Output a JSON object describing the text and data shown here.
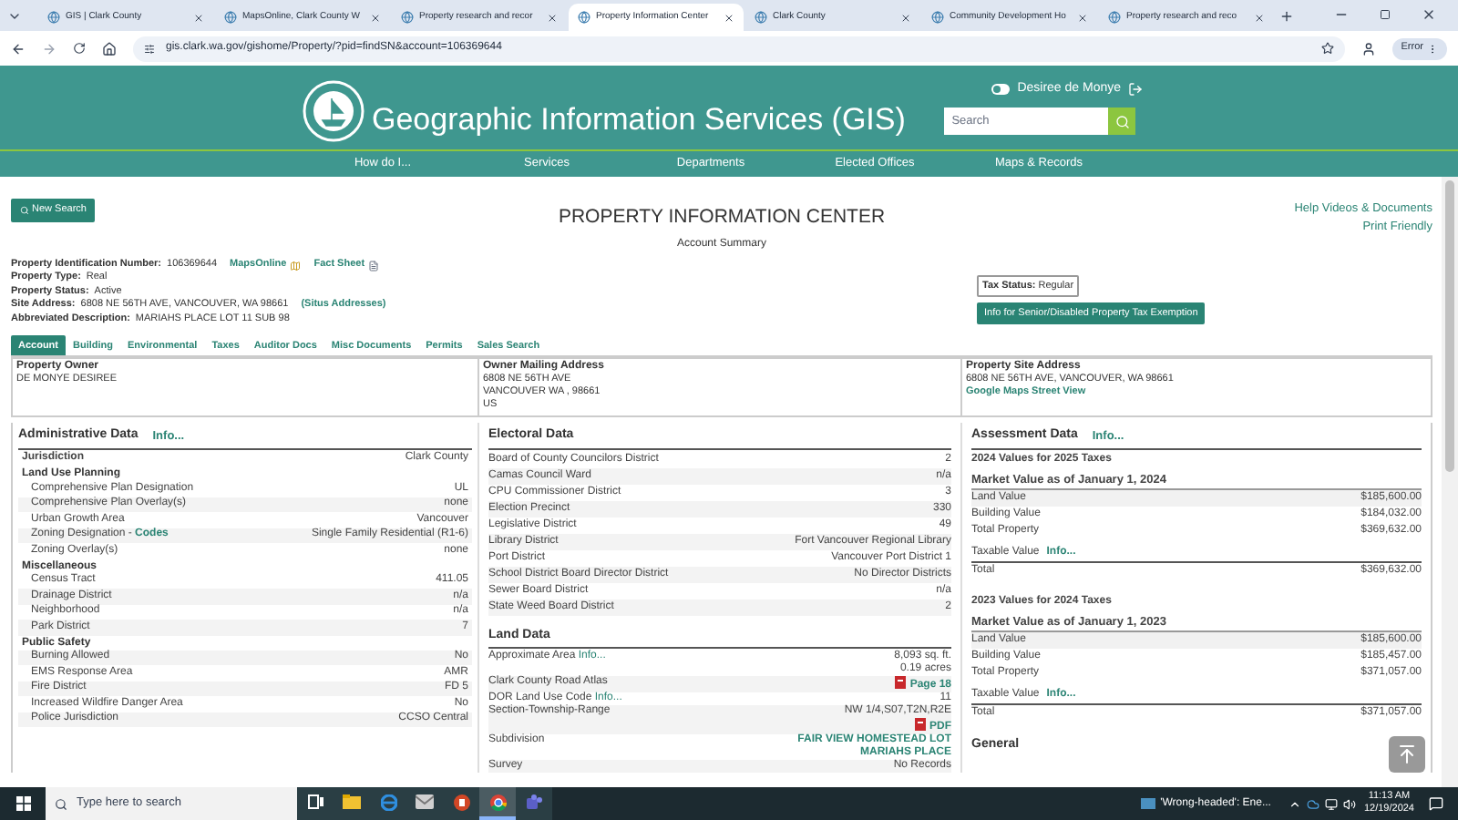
{
  "browser": {
    "tabs": [
      {
        "title": "GIS | Clark County",
        "selected": false
      },
      {
        "title": "MapsOnline, Clark County W",
        "selected": false
      },
      {
        "title": "Property research and recor",
        "selected": false
      },
      {
        "title": "Property Information Center",
        "selected": true
      },
      {
        "title": "Clark County",
        "selected": false
      },
      {
        "title": "Community Development Ho",
        "selected": false
      },
      {
        "title": "Property research and reco",
        "selected": false
      }
    ],
    "address": "gis.clark.wa.gov/gishome/Property/?pid=findSN&account=106369644",
    "profile": "Error"
  },
  "header": {
    "user": "Desiree de Monye",
    "title": "Geographic Information Services (GIS)",
    "search": {
      "placeholder": "Search"
    },
    "nav": [
      "How do I...",
      "Services",
      "Departments",
      "Elected Offices",
      "Maps & Records"
    ]
  },
  "page": {
    "new_search": "New Search",
    "title": "PROPERTY INFORMATION CENTER",
    "subtitle": "Account Summary",
    "links": [
      "Help Videos & Documents",
      "Print Friendly"
    ],
    "fields": [
      {
        "label": "Property Identification Number:",
        "value": "106369644",
        "links": [
          "MapsOnline",
          "Fact Sheet"
        ]
      },
      {
        "label": "Property Type:",
        "value": "Real"
      },
      {
        "label": "Property Status:",
        "value": "Active"
      },
      {
        "label": "Site Address:",
        "value": "6808 NE 56TH AVE, VANCOUVER, WA 98661",
        "links": [
          "(Situs Addresses)"
        ]
      },
      {
        "label": "Abbreviated Description:",
        "value": "MARIAHS PLACE LOT 11 SUB 98"
      }
    ],
    "tax_status": {
      "label": "Tax Status:",
      "value": "Regular"
    },
    "exemption_button": "Info for Senior/Disabled Property Tax Exemption",
    "tabs": [
      {
        "label": "Account",
        "selected": true
      },
      {
        "label": "Building",
        "selected": false
      },
      {
        "label": "Environmental",
        "selected": false
      },
      {
        "label": "Taxes",
        "selected": false
      },
      {
        "label": "Auditor Docs",
        "selected": false
      },
      {
        "label": "Misc Documents",
        "selected": false
      },
      {
        "label": "Permits",
        "selected": false
      },
      {
        "label": "Sales Search",
        "selected": false
      }
    ],
    "owner": {
      "title": "Property Owner",
      "lines": [
        "DE MONYE DESIREE"
      ]
    },
    "mailing": {
      "title": "Owner Mailing Address",
      "lines": [
        "6808 NE 56TH AVE",
        "VANCOUVER WA , 98661",
        "US"
      ]
    },
    "site": {
      "title": "Property Site Address",
      "lines": [
        "6808 NE 56TH AVE, VANCOUVER, WA 98661"
      ],
      "link": "Google Maps Street View"
    }
  },
  "admin": {
    "title": "Administrative Data",
    "link": "Info...",
    "rows": [
      {
        "kind": "main",
        "label": "Jurisdiction",
        "value": "Clark County"
      },
      {
        "kind": "heading",
        "label": "Land Use Planning"
      },
      {
        "kind": "row",
        "label": "Comprehensive Plan Designation",
        "value": "UL"
      },
      {
        "kind": "row",
        "label": "Comprehensive Plan Overlay(s)",
        "value": "none"
      },
      {
        "kind": "row",
        "label": "Urban Growth Area",
        "value": "Vancouver"
      },
      {
        "kind": "row",
        "label": "Zoning Designation -",
        "link": "Codes",
        "value": "Single Family Residential (R1-6)"
      },
      {
        "kind": "row",
        "label": "Zoning Overlay(s)",
        "value": "none"
      },
      {
        "kind": "heading",
        "label": "Miscellaneous"
      },
      {
        "kind": "row",
        "label": "Census Tract",
        "value": "411.05"
      },
      {
        "kind": "row",
        "label": "Drainage District",
        "value": "n/a"
      },
      {
        "kind": "row",
        "label": "Neighborhood",
        "value": "n/a"
      },
      {
        "kind": "row",
        "label": "Park District",
        "value": "7"
      },
      {
        "kind": "heading",
        "label": "Public Safety"
      },
      {
        "kind": "row",
        "label": "Burning Allowed",
        "value": "No"
      },
      {
        "kind": "row",
        "label": "EMS Response Area",
        "value": "AMR"
      },
      {
        "kind": "row",
        "label": "Fire District",
        "value": "FD 5"
      },
      {
        "kind": "row",
        "label": "Increased Wildfire Danger Area",
        "value": "No"
      },
      {
        "kind": "row",
        "label": "Police Jurisdiction",
        "value": "CCSO Central"
      }
    ]
  },
  "electoral": {
    "title": "Electoral Data",
    "rows": [
      {
        "label": "Board of County Councilors District",
        "value": "2"
      },
      {
        "label": "Camas Council Ward",
        "value": "n/a"
      },
      {
        "label": "CPU Commissioner District",
        "value": "3"
      },
      {
        "label": "Election Precinct",
        "value": "330"
      },
      {
        "label": "Legislative District",
        "value": "49"
      },
      {
        "label": "Library District",
        "value": "Fort Vancouver Regional Library"
      },
      {
        "label": "Port District",
        "value": "Vancouver Port District 1"
      },
      {
        "label": "School District Board Director District",
        "value": "No Director Districts"
      },
      {
        "label": "Sewer Board District",
        "value": "n/a"
      },
      {
        "label": "State Weed Board District",
        "value": "2"
      }
    ]
  },
  "land": {
    "title": "Land Data",
    "rows": [
      {
        "label": "Approximate Area",
        "link": "Info...",
        "values": [
          {
            "text": "8,093 sq. ft.",
            "pdf": false,
            "link": false
          },
          {
            "text": "0.19 acres",
            "pdf": false,
            "link": false
          }
        ]
      },
      {
        "label": "Clark County Road Atlas",
        "values": [
          {
            "text": "Page 18",
            "pdf": true,
            "link": true
          }
        ]
      },
      {
        "label": "DOR Land Use Code",
        "link": "Info...",
        "values": [
          {
            "text": "11",
            "pdf": false,
            "link": false
          }
        ]
      },
      {
        "label": "Section-Township-Range",
        "values": [
          {
            "text": "NW 1/4,S07,T2N,R2E",
            "pdf": false,
            "link": false
          },
          {
            "text": "PDF",
            "pdf": true,
            "link": true
          }
        ]
      },
      {
        "label": "Subdivision",
        "values": [
          {
            "text": "FAIR VIEW HOMESTEAD LOT",
            "pdf": false,
            "link": true
          },
          {
            "text": "MARIAHS PLACE",
            "pdf": false,
            "link": true
          }
        ]
      },
      {
        "label": "Survey",
        "values": [
          {
            "text": "No Records",
            "pdf": false,
            "link": false
          }
        ]
      }
    ]
  },
  "assessment": {
    "title": "Assessment Data",
    "link": "Info...",
    "groups": [
      {
        "title": "2024 Values for 2025 Taxes",
        "market": "Market Value as of January 1, 2024",
        "rows": [
          {
            "label": "Land Value",
            "value": "$185,600.00"
          },
          {
            "label": "Building Value",
            "value": "$184,032.00"
          },
          {
            "label": "Total Property",
            "value": "$369,632.00"
          }
        ],
        "taxable": "Taxable Value",
        "taxable_link": "Info...",
        "total": {
          "label": "Total",
          "value": "$369,632.00"
        }
      },
      {
        "title": "2023 Values for 2024 Taxes",
        "market": "Market Value as of January 1, 2023",
        "rows": [
          {
            "label": "Land Value",
            "value": "$185,600.00"
          },
          {
            "label": "Building Value",
            "value": "$185,457.00"
          },
          {
            "label": "Total Property",
            "value": "$371,057.00"
          }
        ],
        "taxable": "Taxable Value",
        "taxable_link": "Info...",
        "total": {
          "label": "Total",
          "value": "$371,057.00"
        }
      }
    ],
    "next": "General"
  },
  "taskbar": {
    "search": {
      "placeholder": "Type here to search"
    },
    "apps": [
      {
        "kind": "taskview",
        "selected": false
      },
      {
        "kind": "folder",
        "selected": false
      },
      {
        "kind": "edge",
        "selected": false
      },
      {
        "kind": "mail",
        "selected": false
      },
      {
        "kind": "powerpoint",
        "selected": false
      },
      {
        "kind": "chrome",
        "selected": true
      },
      {
        "kind": "teams",
        "selected": false
      }
    ],
    "news": "'Wrong-headed': Ene...",
    "time": "11:13 AM",
    "date": "12/19/2024"
  }
}
